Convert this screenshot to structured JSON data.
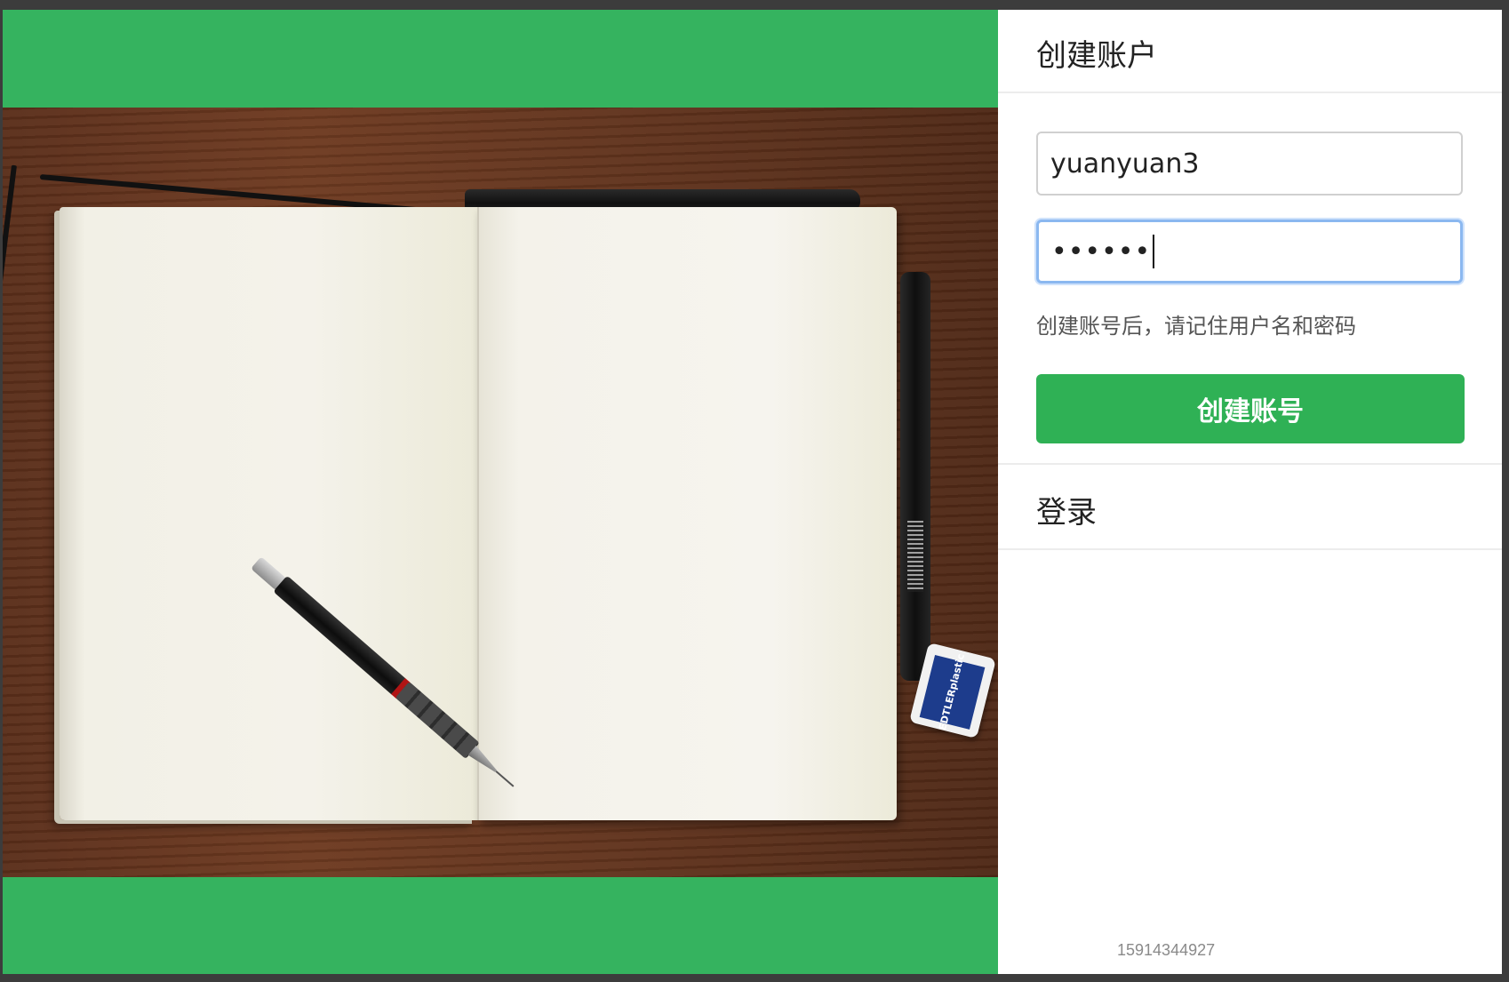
{
  "create_account": {
    "title": "创建账户",
    "username_value": "yuanyuan3",
    "password_value": "••••••",
    "hint": "创建账号后，请记住用户名和密码",
    "submit_label": "创建账号"
  },
  "login": {
    "title": "登录"
  },
  "footer": {
    "phone": "15914344927"
  },
  "hero": {
    "eraser_brand": "EDTLER",
    "eraser_sub": "plastic"
  },
  "colors": {
    "brand_green": "#35b35f",
    "button_green": "#2fb155",
    "focus_blue": "#8bb8f0"
  }
}
